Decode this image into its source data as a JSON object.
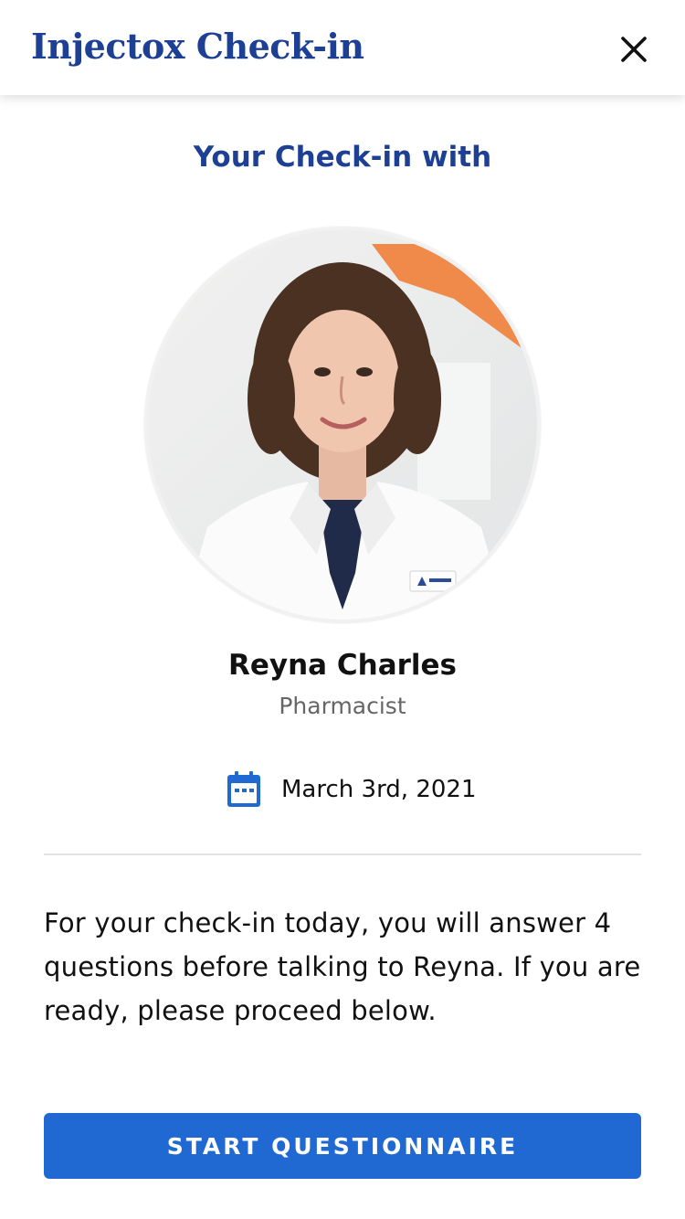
{
  "header": {
    "title": "Injectox Check-in",
    "close_icon": "close-icon"
  },
  "main": {
    "subtitle": "Your Check-in with",
    "person": {
      "name": "Reyna Charles",
      "role": "Pharmacist",
      "photo_icon": "pharmacist-photo"
    },
    "date": {
      "icon": "calendar-icon",
      "text": "March 3rd, 2021"
    },
    "description": "For your check-in today, you will answer 4 questions before talking to Reyna. If you are ready, please proceed below.",
    "start_button_label": "START QUESTIONNAIRE"
  },
  "colors": {
    "brand_navy": "#1d3f94",
    "accent_blue": "#2169d2",
    "text_primary": "#111111",
    "text_secondary": "#666666",
    "divider": "#e2e2e2"
  }
}
